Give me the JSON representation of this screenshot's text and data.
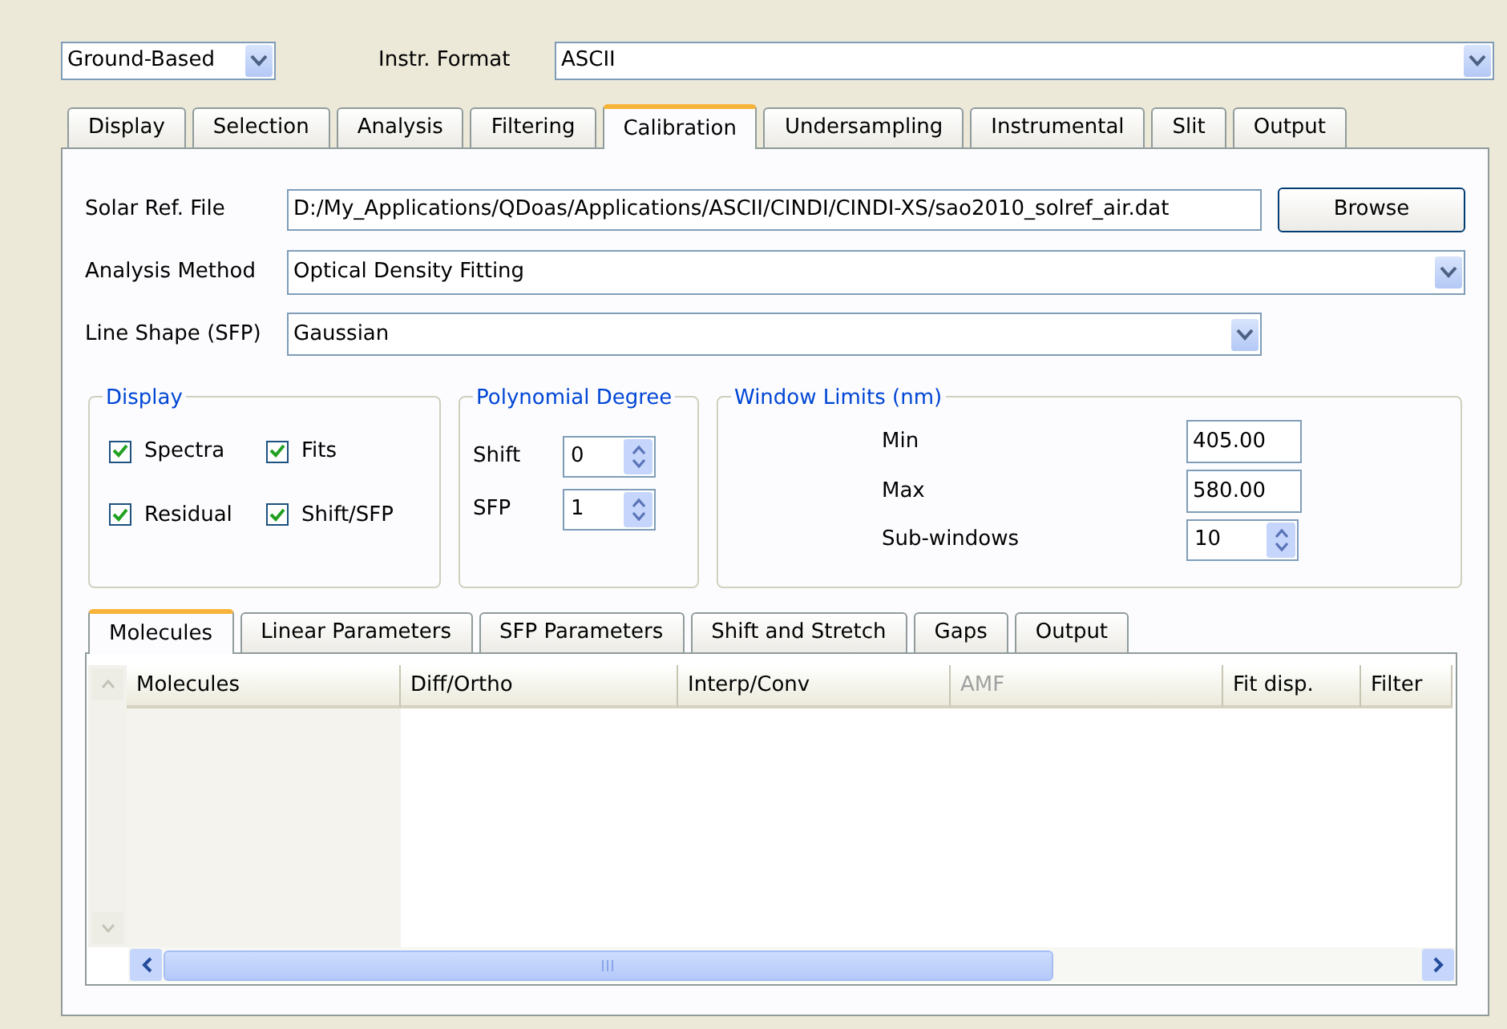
{
  "mode_combo": {
    "value": "Ground-Based"
  },
  "instr_format": {
    "label": "Instr. Format",
    "value": "ASCII"
  },
  "tabs": [
    {
      "label": "Display",
      "selected": false
    },
    {
      "label": "Selection",
      "selected": false
    },
    {
      "label": "Analysis",
      "selected": false
    },
    {
      "label": "Filtering",
      "selected": false
    },
    {
      "label": "Calibration",
      "selected": true
    },
    {
      "label": "Undersampling",
      "selected": false
    },
    {
      "label": "Instrumental",
      "selected": false
    },
    {
      "label": "Slit",
      "selected": false
    },
    {
      "label": "Output",
      "selected": false
    }
  ],
  "solar_ref": {
    "label": "Solar Ref. File",
    "value": "D:/My_Applications/QDoas/Applications/ASCII/CINDI/CINDI-XS/sao2010_solref_air.dat",
    "button": "Browse"
  },
  "analysis_method": {
    "label": "Analysis Method",
    "value": "Optical Density Fitting"
  },
  "line_shape": {
    "label": "Line Shape (SFP)",
    "value": "Gaussian"
  },
  "display_group": {
    "title": "Display",
    "checkboxes": [
      {
        "label": "Spectra",
        "checked": true
      },
      {
        "label": "Fits",
        "checked": true
      },
      {
        "label": "Residual",
        "checked": true
      },
      {
        "label": "Shift/SFP",
        "checked": true
      }
    ]
  },
  "polynomial_group": {
    "title": "Polynomial Degree",
    "spinners": [
      {
        "label": "Shift",
        "value": "0"
      },
      {
        "label": "SFP",
        "value": "1"
      }
    ]
  },
  "window_group": {
    "title": "Window Limits (nm)",
    "fields": [
      {
        "label": "Min",
        "value": "405.00",
        "kind": "text"
      },
      {
        "label": "Max",
        "value": "580.00",
        "kind": "text"
      },
      {
        "label": "Sub-windows",
        "value": "10",
        "kind": "spin"
      }
    ]
  },
  "inner_tabs": [
    {
      "label": "Molecules",
      "selected": true
    },
    {
      "label": "Linear Parameters",
      "selected": false
    },
    {
      "label": "SFP Parameters",
      "selected": false
    },
    {
      "label": "Shift and Stretch",
      "selected": false
    },
    {
      "label": "Gaps",
      "selected": false
    },
    {
      "label": "Output",
      "selected": false
    }
  ],
  "table": {
    "columns": [
      {
        "label": "Molecules",
        "disabled": false
      },
      {
        "label": "Diff/Ortho",
        "disabled": false
      },
      {
        "label": "Interp/Conv",
        "disabled": false
      },
      {
        "label": "AMF",
        "disabled": true
      },
      {
        "label": "Fit disp.",
        "disabled": false
      },
      {
        "label": "Filter",
        "disabled": false
      }
    ]
  }
}
